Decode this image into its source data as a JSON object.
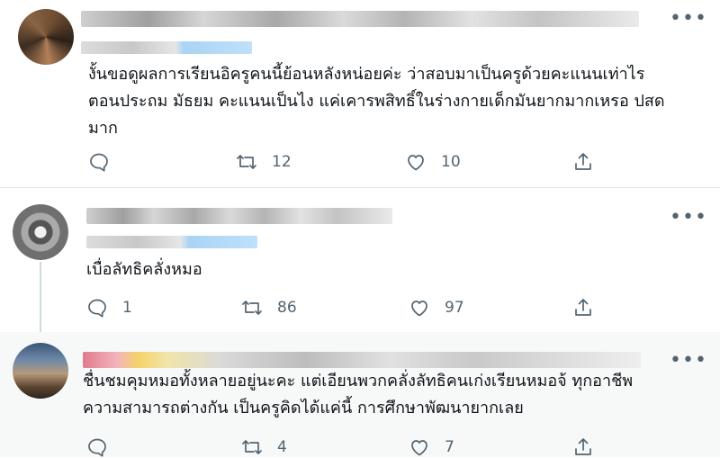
{
  "tweets": [
    {
      "text_lines": [
        "งั้นขอดูผลการเรียนอิครูคนนี้ย้อนหลังหน่อยค่ะ ว่าสอบมาเป็นครูด้วยคะแนนเท่าไร",
        "ตอนประถม มัธยม คะแนนเป็นไง แค่เคารพสิทธิ์ในร่างกายเด็กมันยากมากเหรอ ปสด",
        "มาก"
      ],
      "replies": "",
      "retweets": "12",
      "likes": "10"
    },
    {
      "text_lines": [
        "เบื่อลัทธิคลั่งหมอ"
      ],
      "replies": "1",
      "retweets": "86",
      "likes": "97"
    },
    {
      "text_lines": [
        "ชื่นชมคุมหมอทั้งหลายอยู่นะคะ แต่เอียนพวกคลั่งลัทธิคนเก่งเรียนหมอจ้ ทุกอาชีพ",
        "ความสามารถต่างกัน เป็นครูคิดได้แค่นี้ การศึกษาพัฒนายากเลย"
      ],
      "replies": "",
      "retweets": "4",
      "likes": "7"
    }
  ],
  "icons": {
    "reply": "reply-icon",
    "retweet": "retweet-icon",
    "like": "heart-icon",
    "share": "share-icon",
    "more": "more-icon"
  },
  "colors": {
    "text": "#0f1419",
    "muted": "#536471",
    "highlight_bg": "#f7f9f9",
    "divider": "#e1e5e8"
  }
}
